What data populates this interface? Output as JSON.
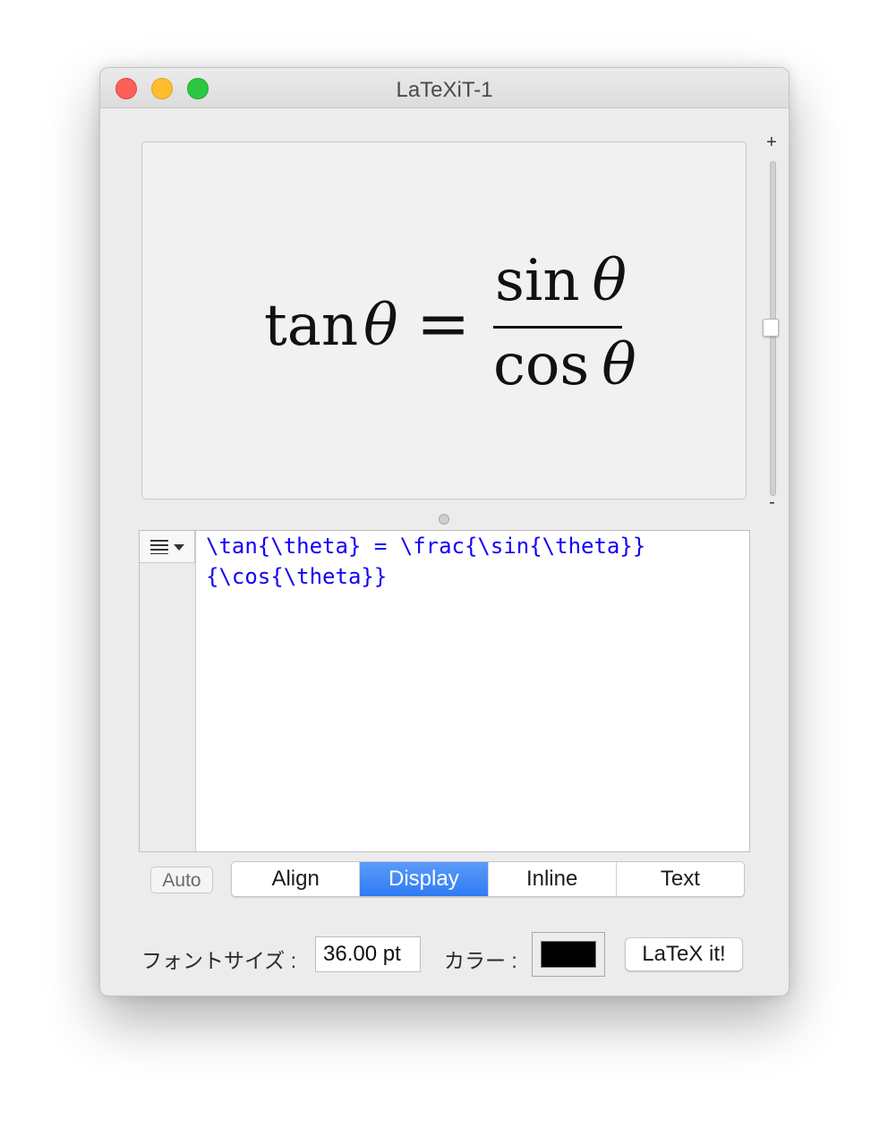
{
  "window": {
    "title": "LaTeXiT-1"
  },
  "preview": {
    "lhs_func": "tan",
    "lhs_var": "θ",
    "equals": "=",
    "num_func": "sin",
    "num_var": "θ",
    "den_func": "cos",
    "den_var": "θ"
  },
  "slider": {
    "plus": "+",
    "minus": "-",
    "level": 0.5
  },
  "editor": {
    "lines": [
      "\\tan{\\theta} = \\frac{\\sin{\\theta}}",
      "{\\cos{\\theta}}"
    ],
    "code_color": "#1400f5"
  },
  "modes": {
    "auto_label": "Auto",
    "items": [
      "Align",
      "Display",
      "Inline",
      "Text"
    ],
    "selected": "Display"
  },
  "bottom": {
    "font_size_label": "フォントサイズ :",
    "font_size_value": "36.00 pt",
    "color_label": "カラー :",
    "color_value": "#000000",
    "latex_button": "LaTeX it!"
  }
}
